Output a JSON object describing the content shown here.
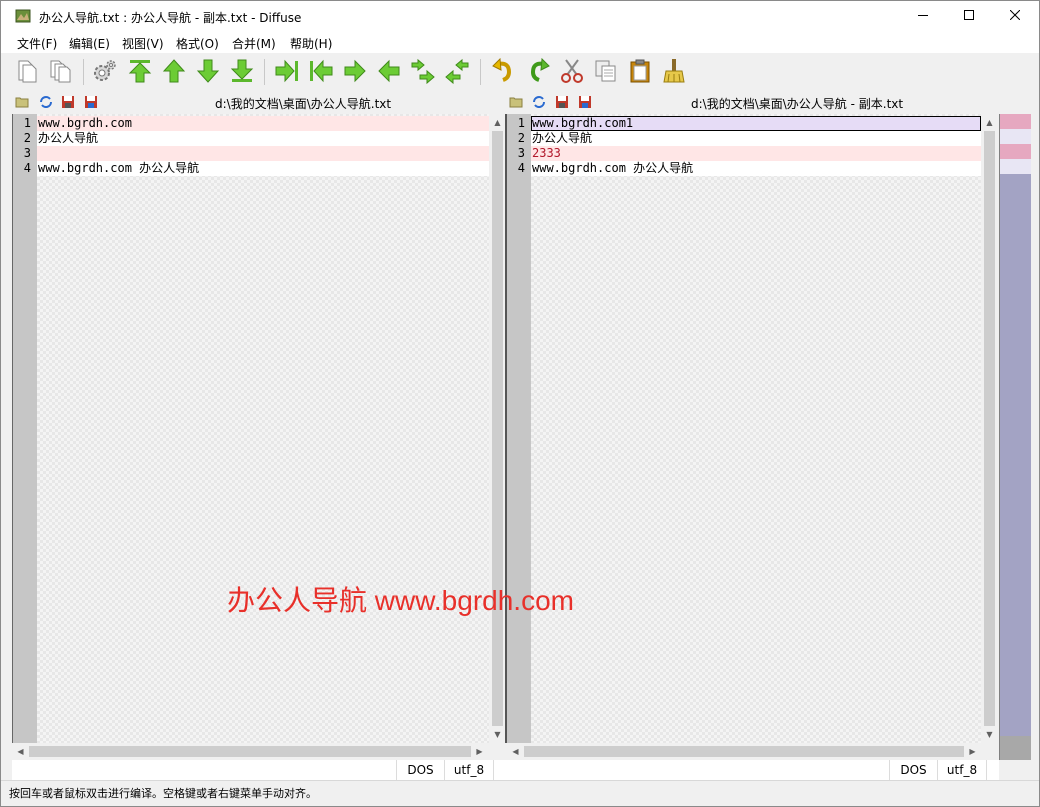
{
  "window": {
    "title": "办公人导航.txt : 办公人导航 - 副本.txt - Diffuse"
  },
  "menu": {
    "items": [
      "文件(F)",
      "编辑(E)",
      "视图(V)",
      "格式(O)",
      "合并(M)",
      "帮助(H)"
    ]
  },
  "toolbar": {
    "icons": [
      "new-2way-icon",
      "new-3way-icon",
      "preferences-icon",
      "first-difference-icon",
      "previous-difference-icon",
      "next-difference-icon",
      "last-difference-icon",
      "copy-right-icon",
      "copy-left-icon",
      "merge-right-icon",
      "merge-left-icon",
      "merge-both-right-icon",
      "merge-both-left-icon",
      "undo-icon",
      "redo-icon",
      "cut-icon",
      "copy-icon",
      "paste-icon",
      "clear-edits-icon"
    ]
  },
  "panes": [
    {
      "path": "d:\\我的文档\\桌面\\办公人导航.txt",
      "lines": [
        {
          "num": "1",
          "text": "www.bgrdh.com",
          "state": "diff"
        },
        {
          "num": "2",
          "text": "办公人导航",
          "state": "same"
        },
        {
          "num": "3",
          "text": "",
          "state": "diff"
        },
        {
          "num": "4",
          "text": "www.bgrdh.com 办公人导航",
          "state": "same"
        }
      ],
      "encoding": {
        "line_ending": "DOS",
        "charset": "utf_8"
      }
    },
    {
      "path": "d:\\我的文档\\桌面\\办公人导航 - 副本.txt",
      "lines": [
        {
          "num": "1",
          "text": "www.bgrdh.com1",
          "state": "mod"
        },
        {
          "num": "2",
          "text": "办公人导航",
          "state": "same"
        },
        {
          "num": "3",
          "text": "2333",
          "state": "diff"
        },
        {
          "num": "4",
          "text": "www.bgrdh.com 办公人导航",
          "state": "same"
        }
      ],
      "encoding": {
        "line_ending": "DOS",
        "charset": "utf_8"
      }
    }
  ],
  "status": {
    "text": "按回车或者鼠标双击进行编译。空格键或者右键菜单手动对齐。"
  },
  "watermark": {
    "text": "办公人导航 www.bgrdh.com"
  },
  "colors": {
    "diff_line": "#ffe6e6",
    "modified_line": "#e6dcf6",
    "overview": "#a3a3c4",
    "watermark": "#e8302a"
  }
}
